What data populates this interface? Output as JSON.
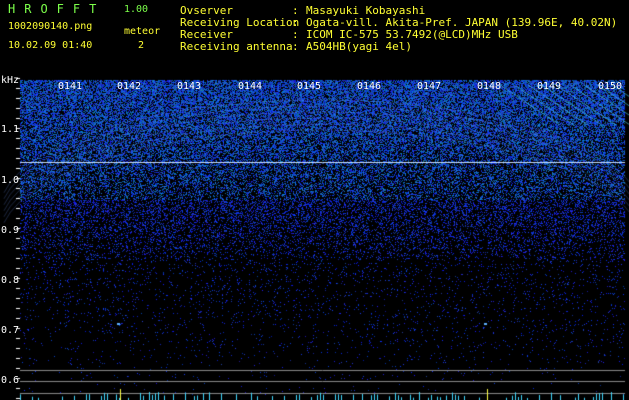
{
  "header": {
    "app_title": "HROFFT",
    "version": "1.00",
    "filename": "1002090140.png",
    "datetime": "10.02.09 01:40",
    "meteor_label": "meteor",
    "meteor_count": "2"
  },
  "info": [
    {
      "key": "Ovserver",
      "sep": ":",
      "value": "Masayuki Kobayashi"
    },
    {
      "key": "Receiving Location",
      "sep": ":",
      "value": "Ogata-vill. Akita-Pref. JAPAN (139.96E, 40.02N)"
    },
    {
      "key": "Receiver",
      "sep": ":",
      "value": "ICOM IC-575 53.7492(@LCD)MHz USB"
    },
    {
      "key": "Receiving antenna",
      "sep": ":",
      "value": "A504HB(yagi 4el)"
    }
  ],
  "axis": {
    "unit": "kHz",
    "ticks": [
      "1.1",
      "1.0",
      "0.9",
      "0.8",
      "0.7",
      "0.6"
    ]
  },
  "time_markers": [
    "0141",
    "0142",
    "0143",
    "0144",
    "0145",
    "0146",
    "0147",
    "0148",
    "0149",
    "0150"
  ],
  "colors": {
    "accent_green": "#7cff4a",
    "accent_yellow": "#ffff33",
    "noise_blue": "#2b4dff",
    "reference_line": "#c8e0ff"
  }
}
